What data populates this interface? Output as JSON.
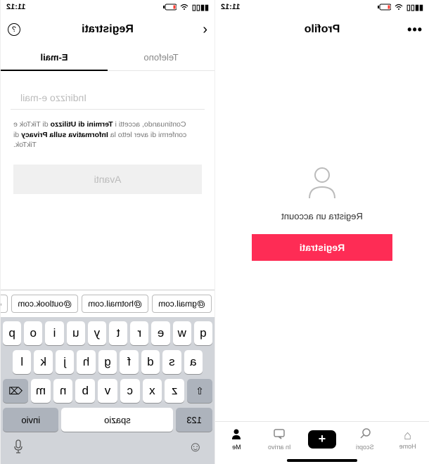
{
  "left": {
    "time": "11:12",
    "title": "Registrati",
    "tabs": {
      "phone": "Telefono",
      "email": "E-mail"
    },
    "email_placeholder": "Indirizzo e-mail",
    "terms_pre": "Continuando, accetti i ",
    "terms_tou": "Termini di Utilizzo",
    "terms_mid": " di TikTok e confermi di aver letto la ",
    "terms_privacy": "Informativa sulla Privacy",
    "terms_post": " di TikTok.",
    "next": "Avanti",
    "suggestions": [
      "@gmail.com",
      "@hotmail.com",
      "@outlook.com",
      "@ya"
    ],
    "keys_r1": [
      "q",
      "w",
      "e",
      "r",
      "t",
      "y",
      "u",
      "i",
      "o",
      "p"
    ],
    "keys_r2": [
      "a",
      "s",
      "d",
      "f",
      "g",
      "h",
      "j",
      "k",
      "l"
    ],
    "keys_r3": [
      "z",
      "x",
      "c",
      "v",
      "b",
      "n",
      "m"
    ],
    "key_shift": "⇧",
    "key_del": "⌫",
    "key_num": "123",
    "key_space": "spazio",
    "key_return": "invio"
  },
  "right": {
    "time": "11:12",
    "title": "Profilo",
    "register_prompt": "Registra un account",
    "register_btn": "Registrati",
    "nav": {
      "home": "Home",
      "discover": "Scopri",
      "inbox": "In arrivo",
      "me": "Me"
    }
  }
}
